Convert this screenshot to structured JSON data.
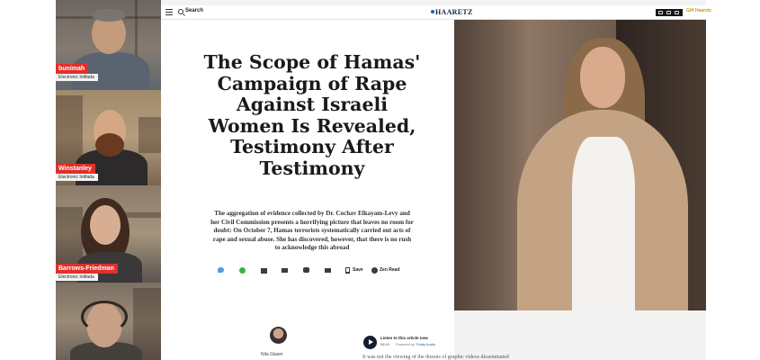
{
  "participants": [
    {
      "name": "bunimah",
      "outlet": "Electronic Intifada",
      "skin": "#c49a7c",
      "shirt": "#5a6470",
      "hair": "#7a7470"
    },
    {
      "name": "Winstanley",
      "outlet": "Electronic Intifada",
      "skin": "#d4a884",
      "shirt": "#2c2a2a",
      "hair": "#6a3a20"
    },
    {
      "name": "Barrows-Friedman",
      "outlet": "Electronic Intifada",
      "skin": "#d8ae92",
      "shirt": "#3a3838",
      "hair": "#3e2a1e"
    },
    {
      "name": "",
      "outlet": "",
      "skin": "#c8a086",
      "shirt": "#44403c",
      "hair": "#2e2620"
    }
  ],
  "browser": {
    "search_label": "Search",
    "logo": "HAARETZ",
    "promo_text": "Gift Haaretz"
  },
  "article": {
    "headline": "The Scope of Hamas' Campaign of Rape Against Israeli Women Is Revealed, Testimony After Testimony",
    "deck": "The aggregation of evidence collected by Dr. Cochav Elkayam-Levy and her Civil Commission presents a horrifying picture that leaves no room for doubt: On October 7, Hamas terrorists systematically carried out acts of rape and sexual abuse. She has discovered, however, that there is no rush to acknowledge this abroad",
    "share": {
      "save_label": "Save",
      "gift_label": "Zen Read"
    },
    "author_name": "Nila Glaser",
    "audio": {
      "label": "Listen to this article now",
      "time": "08:19",
      "credit_prefix": "Powered by",
      "credit_brand": "Trinity Audio"
    },
    "body_start": "It was not the viewing of the dozens of graphic videos disseminated"
  },
  "colors": {
    "name_tag": "#e0302a",
    "headline": "#1a1a1a",
    "logo": "#14243c",
    "twitter": "#4e9ee0",
    "whatsapp": "#36b24a",
    "audio_play": "#141e32"
  }
}
